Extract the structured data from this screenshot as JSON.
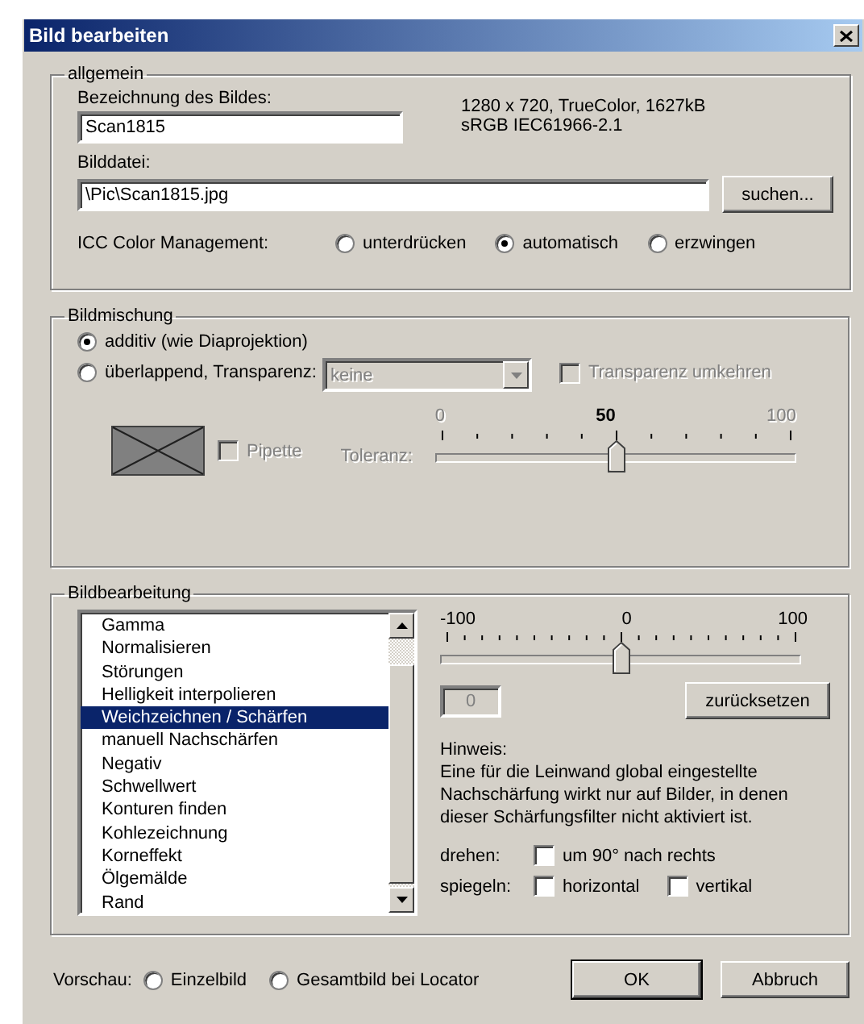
{
  "window": {
    "title": "Bild bearbeiten"
  },
  "general": {
    "legend": "allgemein",
    "name_label": "Bezeichnung des Bildes:",
    "name_value": "Scan1815",
    "info": [
      "1280 x 720, TrueColor, 1627kB",
      "sRGB IEC61966-2.1"
    ],
    "file_label": "Bilddatei:",
    "file_value": "\\Pic\\Scan1815.jpg",
    "browse": "suchen...",
    "icc_label": "ICC Color Management:",
    "icc_options": [
      {
        "label": "unterdrücken",
        "selected": false
      },
      {
        "label": "automatisch",
        "selected": true
      },
      {
        "label": "erzwingen",
        "selected": false
      }
    ]
  },
  "blend": {
    "legend": "Bildmischung",
    "modes": [
      {
        "label": "additiv (wie Diaprojektion)",
        "selected": true
      },
      {
        "label": "überlappend, Transparenz:",
        "selected": false
      }
    ],
    "transparency": {
      "value": "keine",
      "disabled": true
    },
    "invert": {
      "label": "Transparenz umkehren",
      "checked": false,
      "disabled": true
    },
    "pipette": {
      "label": "Pipette",
      "checked": false,
      "disabled": true
    },
    "tolerance": {
      "label": "Toleranz:",
      "disabled": true,
      "level": 0.5,
      "ticks": [
        {
          "label": "0",
          "current": false
        },
        {
          "label": "50",
          "current": true
        },
        {
          "label": "100",
          "current": false
        }
      ]
    }
  },
  "edit": {
    "legend": "Bildbearbeitung",
    "filters": [
      {
        "label": "Gamma",
        "selected": false
      },
      {
        "label": "Normalisieren",
        "selected": false
      },
      {
        "label": "Störungen",
        "selected": false
      },
      {
        "label": "Helligkeit interpolieren",
        "selected": false
      },
      {
        "label": "Weichzeichnen / Schärfen",
        "selected": true
      },
      {
        "label": "manuell Nachschärfen",
        "selected": false
      },
      {
        "label": "Negativ",
        "selected": false
      },
      {
        "label": "Schwellwert",
        "selected": false
      },
      {
        "label": "Konturen finden",
        "selected": false
      },
      {
        "label": "Kohlezeichnung",
        "selected": false
      },
      {
        "label": "Korneffekt",
        "selected": false
      },
      {
        "label": "Ölgemälde",
        "selected": false
      },
      {
        "label": "Rand",
        "selected": false
      }
    ],
    "slider": {
      "level": 0.5,
      "ticks": [
        "-100",
        "0",
        "100"
      ]
    },
    "value_field": {
      "value": "0",
      "disabled": true
    },
    "reset": "zurücksetzen",
    "note_title": "Hinweis:",
    "note": "Eine für die Leinwand global eingestellte Nachschärfung wirkt nur auf Bilder, in denen dieser Schärfungsfilter nicht aktiviert ist.",
    "rotate_label": "drehen:",
    "rotate": {
      "label": "um 90° nach rechts",
      "checked": false
    },
    "mirror_label": "spiegeln:",
    "mirror": [
      {
        "label": "horizontal",
        "checked": false
      },
      {
        "label": "vertikal",
        "checked": false
      }
    ]
  },
  "footer": {
    "preview_label": "Vorschau:",
    "preview": [
      {
        "label": "Einzelbild",
        "selected": false
      },
      {
        "label": "Gesamtbild bei Locator",
        "selected": false
      }
    ],
    "buttons": [
      {
        "label": "OK",
        "default": true
      },
      {
        "label": "Abbruch",
        "default": false
      }
    ]
  }
}
